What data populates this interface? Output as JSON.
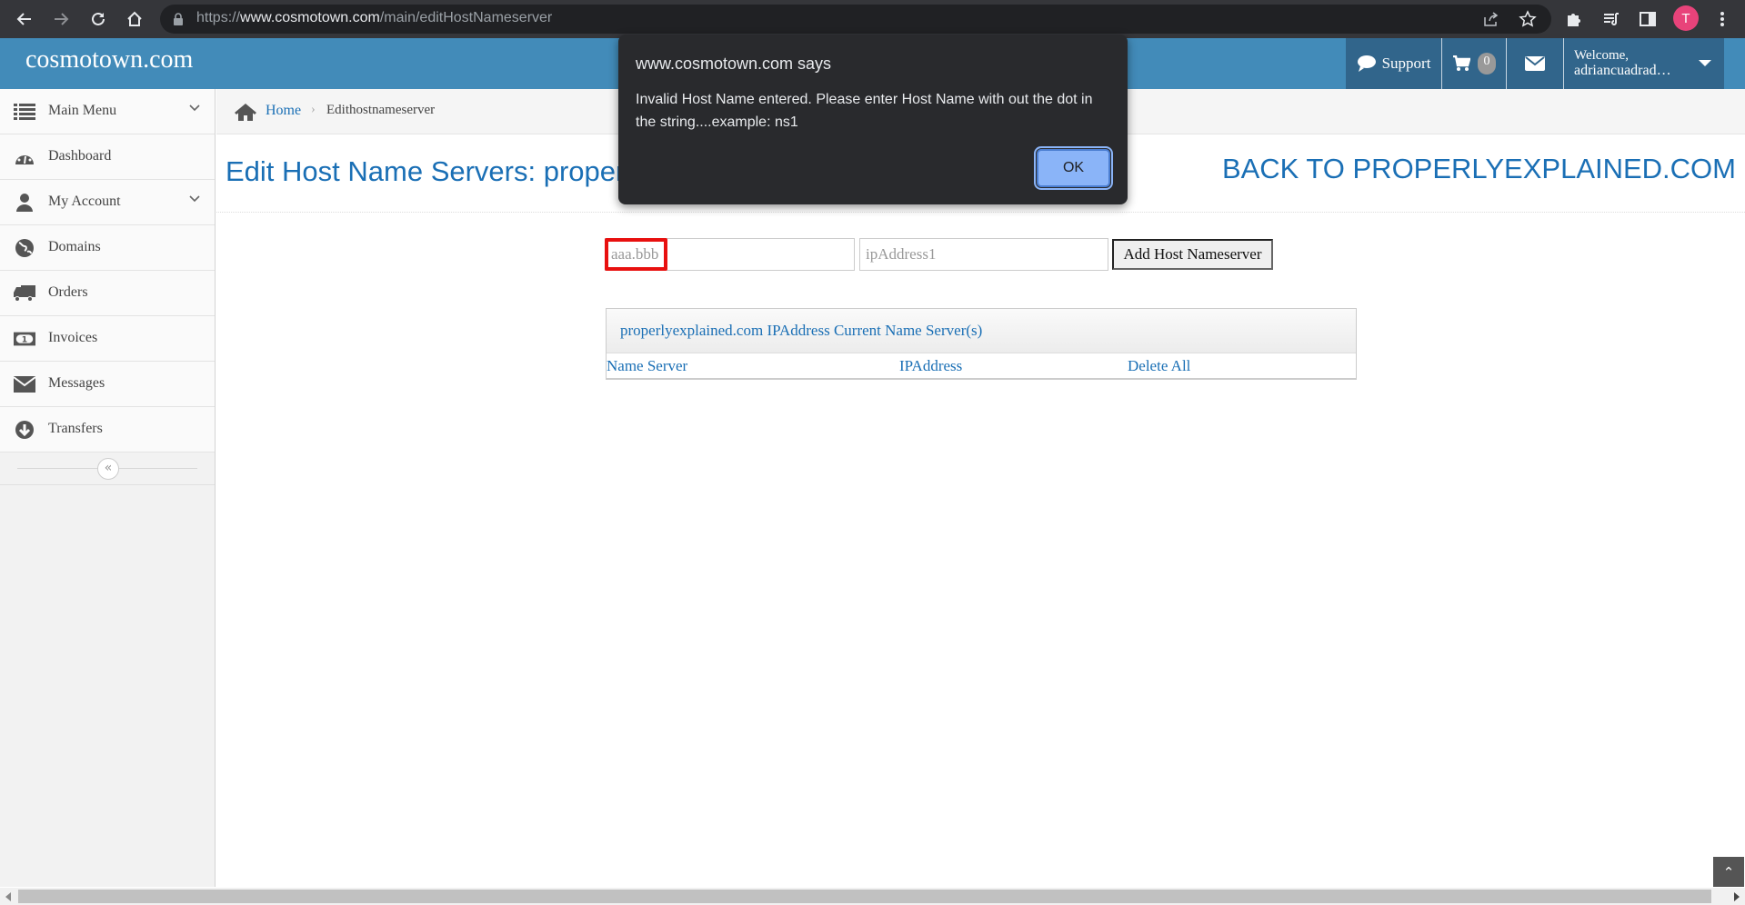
{
  "browser": {
    "url_prefix": "https://",
    "url_host": "www.cosmotown.com",
    "url_path": "/main/editHostNameserver",
    "profile_initial": "T"
  },
  "header": {
    "logo": "cosmotown.com",
    "support_label": "Support",
    "cart_count": "0",
    "welcome_line1": "Welcome,",
    "welcome_user": "adriancuadrad…"
  },
  "sidebar": {
    "items": [
      {
        "label": "Main Menu",
        "icon": "list-icon",
        "has_chevron": true
      },
      {
        "label": "Dashboard",
        "icon": "dashboard-icon",
        "has_chevron": false
      },
      {
        "label": "My Account",
        "icon": "user-icon",
        "has_chevron": true
      },
      {
        "label": "Domains",
        "icon": "globe-icon",
        "has_chevron": false
      },
      {
        "label": "Orders",
        "icon": "truck-icon",
        "has_chevron": false
      },
      {
        "label": "Invoices",
        "icon": "money-icon",
        "has_chevron": false
      },
      {
        "label": "Messages",
        "icon": "envelope-icon",
        "has_chevron": false
      },
      {
        "label": "Transfers",
        "icon": "download-circle-icon",
        "has_chevron": false
      }
    ],
    "collapse_label": "«"
  },
  "breadcrumb": {
    "home": "Home",
    "separator": "›",
    "current": "Edithostnameserver"
  },
  "main": {
    "title": "Edit Host Name Servers: properlyexplained.com",
    "back_link": "BACK TO PROPERLYEXPLAINED.COM",
    "host_input": {
      "value": "",
      "placeholder": "aaa.bbb"
    },
    "ip_input": {
      "value": "",
      "placeholder": "ipAddress1"
    },
    "add_button": "Add Host Nameserver",
    "table": {
      "caption": "properlyexplained.com IPAddress Current Name Server(s)",
      "columns": [
        "Name Server",
        "IPAddress",
        "Delete All"
      ],
      "rows": []
    }
  },
  "dialog": {
    "title": "www.cosmotown.com says",
    "message": "Invalid Host Name entered. Please enter Host Name with out the dot in the string....example: ns1",
    "ok_label": "OK"
  },
  "colors": {
    "header_blue": "#428bb9",
    "header_dark": "#31658b",
    "link_blue": "#1a6fb5",
    "error_red": "#e8100f",
    "dialog_bg": "#292a2d",
    "ok_button": "#8ab4f8"
  }
}
